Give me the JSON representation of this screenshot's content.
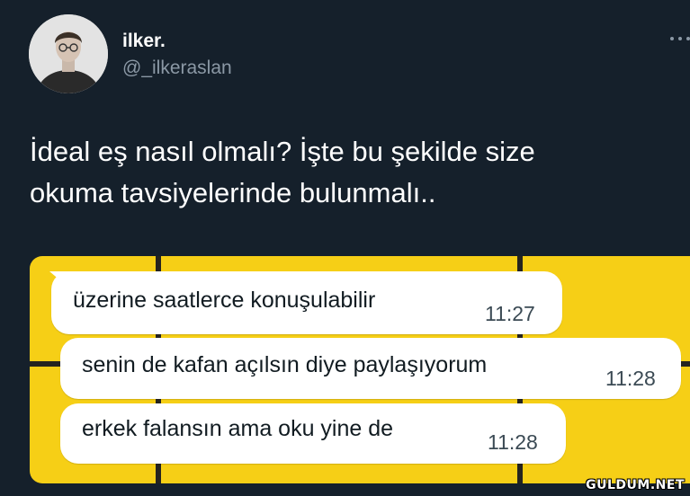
{
  "author": {
    "display_name": "ilker.",
    "handle": "@_ilkeraslan"
  },
  "tweet": {
    "text": "İdeal eş nasıl olmalı? İşte bu şekilde size\nokuma tavsiyelerinde bulunmalı.."
  },
  "media": {
    "background_color": "#f6cf16",
    "messages": [
      {
        "text": "üzerine saatlerce konuşulabilir",
        "time": "11:27"
      },
      {
        "text": "senin de kafan açılsın diye paylaşıyorum",
        "time": "11:28"
      },
      {
        "text": "erkek falansın ama oku yine de",
        "time": "11:28"
      }
    ]
  },
  "watermark": "GULDUM.NET",
  "icons": {
    "more": "more-dots-icon",
    "avatar": "profile-photo"
  }
}
